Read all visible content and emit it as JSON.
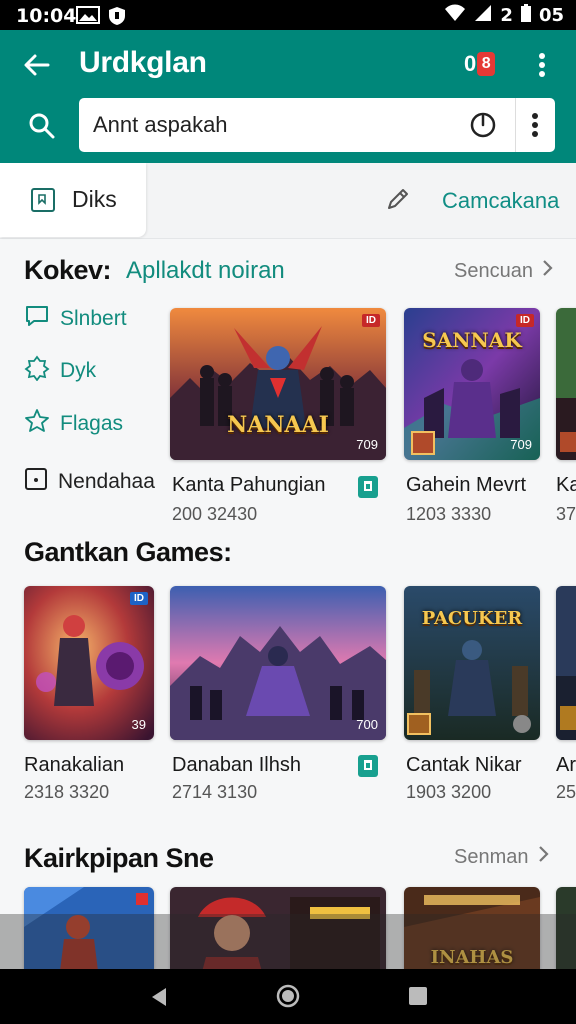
{
  "status_bar": {
    "time": "10:04",
    "battery_text": "2",
    "right_text": "05"
  },
  "app_bar": {
    "title": "Urdkglan",
    "notification_text": "0",
    "notification_badge": "8"
  },
  "search": {
    "value": "Annt aspakah",
    "placeholder": ""
  },
  "tabs": {
    "active_label": "Diks",
    "right_label": "Camcakana"
  },
  "section1": {
    "title": "Kokev:",
    "subtitle": "Apllakdt noiran",
    "see_more": "Sencuan"
  },
  "sidebar": {
    "items": [
      {
        "label": "Slnbert",
        "icon": "chat-icon"
      },
      {
        "label": "Dyk",
        "icon": "badge-icon"
      },
      {
        "label": "Flagas",
        "icon": "star-badge-icon"
      },
      {
        "label": "Nendahaa",
        "icon": "box-icon"
      }
    ]
  },
  "row1": [
    {
      "name": "Kanta Pahungian",
      "meta": "200 32430",
      "cover_title": "NANAAI",
      "cover_rating": "709",
      "badge": "ID"
    },
    {
      "name": "Gahein Mevrt",
      "meta": "1203 3330",
      "cover_title": "SANNAK",
      "cover_rating": "709",
      "badge": "ID"
    },
    {
      "name": "Ka",
      "meta": "37"
    }
  ],
  "section2": {
    "title": "Gantkan Games:"
  },
  "row2": [
    {
      "name": "Ranakalian",
      "meta": "2318 3320",
      "cover_rating": "39",
      "badge": "ID"
    },
    {
      "name": "Danaban Ilhsh",
      "meta": "2714 3130",
      "cover_rating": "700"
    },
    {
      "name": "Cantak Nikar",
      "meta": "1903 3200",
      "cover_title": "PACUKER",
      "badge": ""
    },
    {
      "name": "Ar",
      "meta": "25"
    }
  ],
  "section3": {
    "title": "Kairkpipan Sne",
    "see_more": "Senman"
  },
  "row3": [
    {
      "cover_title": ""
    },
    {
      "cover_title": ""
    },
    {
      "cover_title": "INAHAS"
    }
  ],
  "colors": {
    "primary": "#00877a",
    "accent_green": "#128c7e",
    "background": "#f6f7f8"
  }
}
